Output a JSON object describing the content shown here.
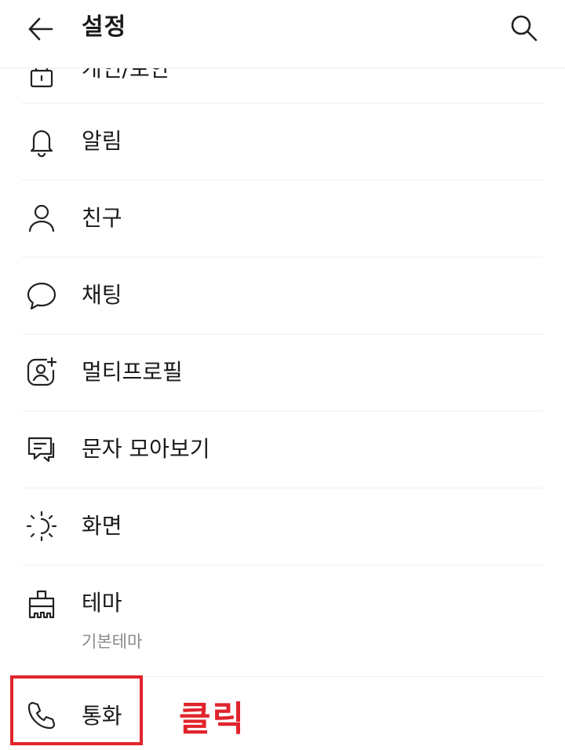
{
  "header": {
    "title": "설정",
    "back_icon": "arrow-left-icon",
    "search_icon": "search-icon"
  },
  "menu": {
    "partial_top_label": "개인/보안",
    "items": [
      {
        "label": "알림",
        "icon": "bell-icon"
      },
      {
        "label": "친구",
        "icon": "person-icon"
      },
      {
        "label": "채팅",
        "icon": "chat-bubble-icon"
      },
      {
        "label": "멀티프로필",
        "icon": "multi-profile-icon"
      },
      {
        "label": "문자 모아보기",
        "icon": "message-collect-icon"
      },
      {
        "label": "화면",
        "icon": "brightness-icon"
      },
      {
        "label": "테마",
        "sublabel": "기본테마",
        "icon": "theme-brush-icon"
      },
      {
        "label": "통화",
        "icon": "phone-icon"
      }
    ]
  },
  "annotation": {
    "text": "클릭",
    "color": "#e0242c"
  }
}
